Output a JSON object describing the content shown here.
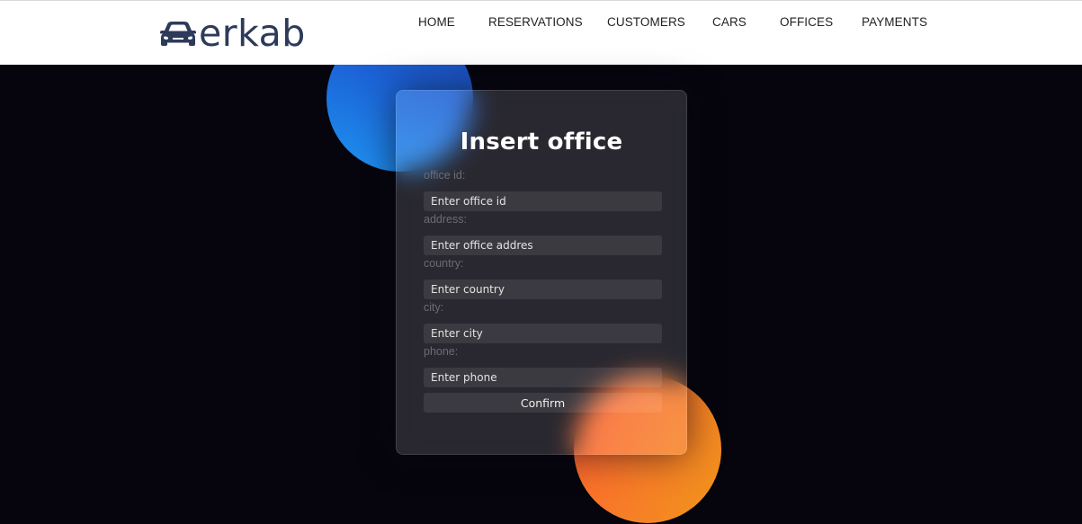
{
  "brand": {
    "logo_text": "erkab",
    "logo_icon": "car-icon"
  },
  "nav": {
    "items": [
      {
        "label": "HOME"
      },
      {
        "label": "RESERVATIONS"
      },
      {
        "label": "CUSTOMERS"
      },
      {
        "label": "CARS"
      },
      {
        "label": "OFFICES"
      },
      {
        "label": "PAYMENTS"
      }
    ]
  },
  "form": {
    "title": "Insert office",
    "fields": [
      {
        "label": "office id:",
        "placeholder": "Enter office id",
        "value": ""
      },
      {
        "label": "address:",
        "placeholder": "Enter office addres",
        "value": ""
      },
      {
        "label": "country:",
        "placeholder": "Enter country",
        "value": ""
      },
      {
        "label": "city:",
        "placeholder": "Enter city",
        "value": ""
      },
      {
        "label": "phone:",
        "placeholder": "Enter phone",
        "value": ""
      }
    ],
    "confirm_label": "Confirm"
  },
  "colors": {
    "background": "#06050e",
    "header_bg": "#ffffff",
    "logo": "#2d3a5a",
    "blob_blue": "#1e94f1",
    "blob_orange": "#f77a28"
  }
}
